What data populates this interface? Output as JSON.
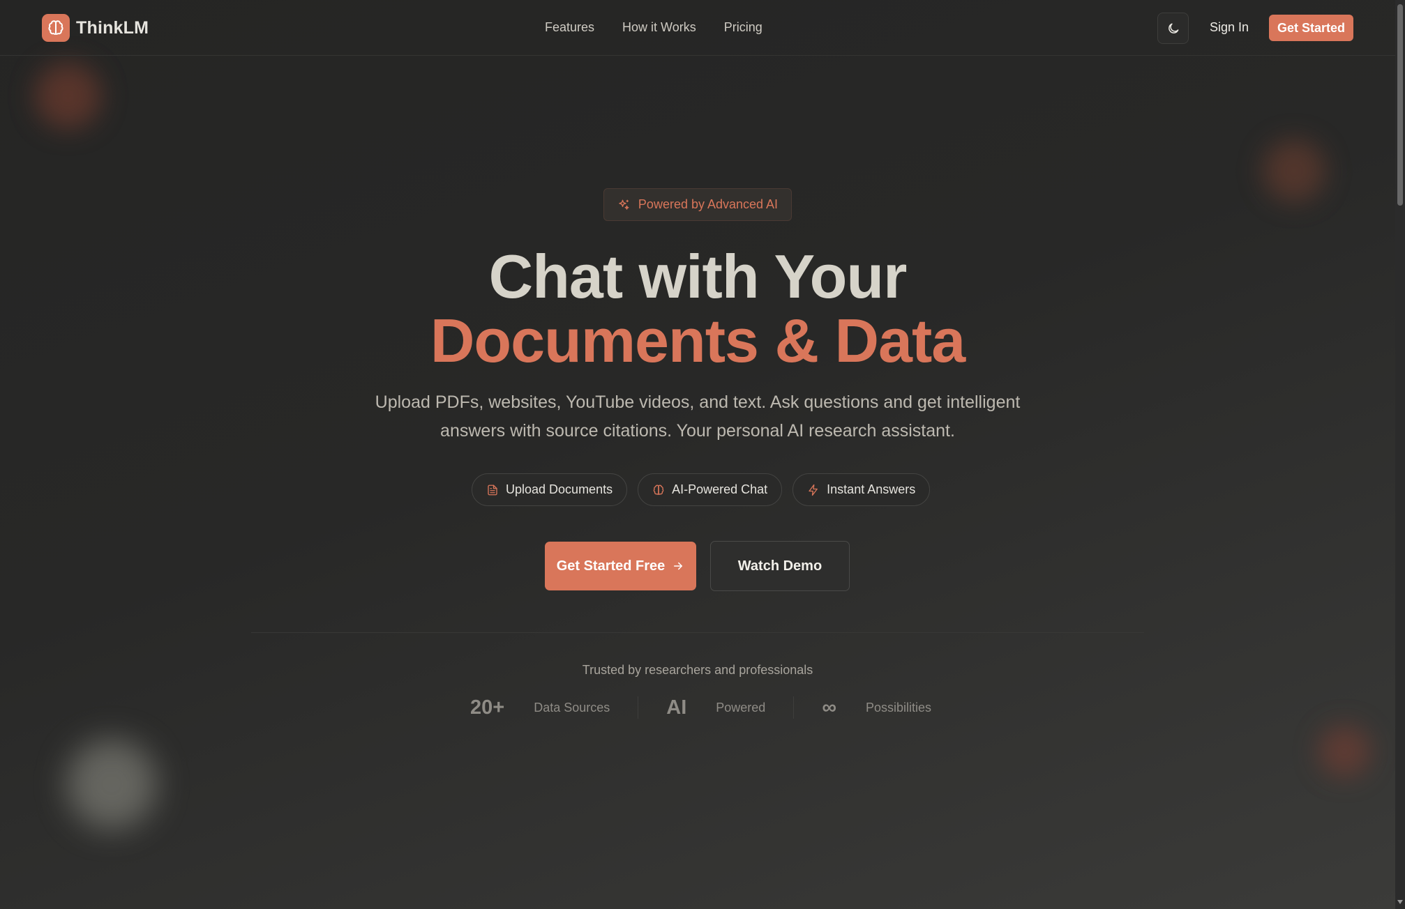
{
  "header": {
    "brand": "ThinkLM",
    "nav": [
      "Features",
      "How it Works",
      "Pricing"
    ],
    "sign_in": "Sign In",
    "get_started": "Get Started",
    "theme_icon": "moon-icon"
  },
  "hero": {
    "badge": "Powered by Advanced AI",
    "title_line1": "Chat with Your",
    "title_line2": "Documents & Data",
    "subtitle_line1": "Upload PDFs, websites, YouTube videos, and text. Ask questions and get intelligent",
    "subtitle_line2": "answers with source citations. Your personal AI research assistant.",
    "pills": [
      {
        "label": "Upload Documents",
        "icon": "document-icon"
      },
      {
        "label": "AI-Powered Chat",
        "icon": "brain-icon"
      },
      {
        "label": "Instant Answers",
        "icon": "lightning-icon"
      }
    ],
    "cta_primary": "Get Started Free",
    "cta_secondary": "Watch Demo"
  },
  "trust": {
    "text": "Trusted by researchers and professionals",
    "stats": [
      {
        "value": "20+",
        "label": "Data Sources"
      },
      {
        "value": "AI",
        "label": "Powered"
      },
      {
        "value": "∞",
        "label": "Possibilities"
      }
    ]
  },
  "colors": {
    "accent": "#d9765a",
    "background": "#262625",
    "text": "#e6e4de"
  }
}
